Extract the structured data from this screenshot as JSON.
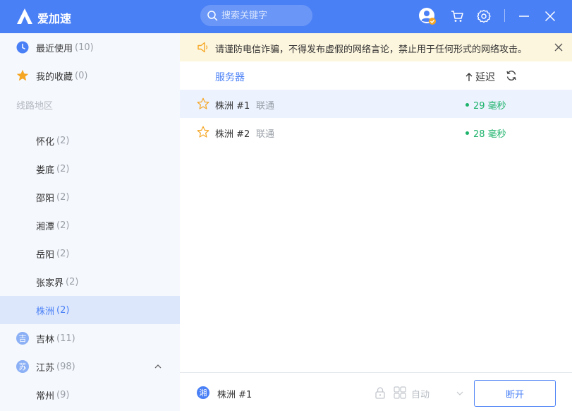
{
  "app": {
    "name": "爱加速"
  },
  "search": {
    "placeholder": "搜索关键字"
  },
  "sidebar": {
    "recent": {
      "label": "最近使用",
      "count": "(10)"
    },
    "favorites": {
      "label": "我的收藏",
      "count": "(0)"
    },
    "section_title": "线路地区",
    "cities": [
      {
        "label": "怀化",
        "count": "(2)"
      },
      {
        "label": "娄底",
        "count": "(2)"
      },
      {
        "label": "邵阳",
        "count": "(2)"
      },
      {
        "label": "湘潭",
        "count": "(2)"
      },
      {
        "label": "岳阳",
        "count": "(2)"
      },
      {
        "label": "张家界",
        "count": "(2)"
      },
      {
        "label": "株洲",
        "count": "(2)",
        "active": true
      }
    ],
    "provinces": [
      {
        "badge": "吉",
        "label": "吉林",
        "count": "(11)"
      },
      {
        "badge": "苏",
        "label": "江苏",
        "count": "(98)",
        "expanded": true
      }
    ],
    "sub_cities": [
      {
        "label": "常州",
        "count": "(9)"
      }
    ]
  },
  "notice": {
    "text": "请谨防电信诈骗，不得发布虚假的网络言论，禁止用于任何形式的网络攻击。"
  },
  "list": {
    "col_server": "服务器",
    "col_delay": "延迟",
    "rows": [
      {
        "name": "株洲 #1",
        "isp": "联通",
        "latency": "29 毫秒",
        "highlighted": true
      },
      {
        "name": "株洲 #2",
        "isp": "联通",
        "latency": "28 毫秒",
        "highlighted": false
      }
    ]
  },
  "bottom": {
    "badge": "湘",
    "connected_name": "株洲 #1",
    "mode": "自动",
    "disconnect_label": "断开"
  },
  "colors": {
    "accent": "#4a80f6",
    "latency_good": "#1db36b",
    "notice_bg": "#fdf6de",
    "star": "#f5a623"
  },
  "icons": [
    "logo-icon",
    "search-icon",
    "avatar-icon",
    "cart-icon",
    "gear-icon",
    "minimize-icon",
    "close-icon",
    "clock-icon",
    "star-icon",
    "speaker-icon",
    "refresh-icon",
    "lock-icon",
    "grid-icon",
    "chevron-down-icon",
    "chevron-up-icon"
  ]
}
